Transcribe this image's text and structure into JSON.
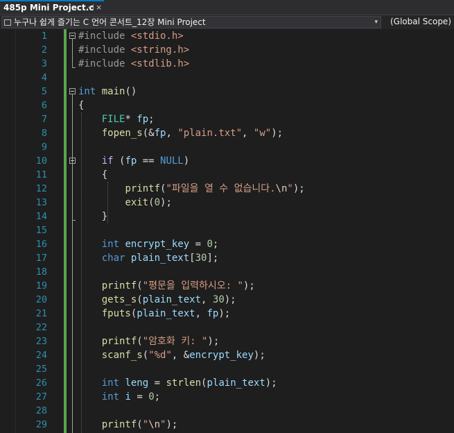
{
  "tab": {
    "title": "485p Mini Project.c",
    "pin": "⊣",
    "close": "×"
  },
  "navbar": {
    "project_scope": "누구나 쉽게 즐기는 C 언어 콘서트_12장 Mini Project",
    "dropdown_glyph": "▾",
    "global_scope": "(Global Scope)"
  },
  "colors": {
    "keyword": "#569cd6",
    "type": "#4ec9b0",
    "function": "#dcdcaa",
    "variable": "#9cdcfe",
    "string": "#d69d85",
    "number": "#b5cea8",
    "line_number": "#2b91af",
    "change_bar": "#57a64a",
    "accent": "#007acc"
  },
  "editor": {
    "lines": [
      {
        "n": "1",
        "tokens": [
          [
            "p",
            "#include "
          ],
          [
            "s",
            "<stdio.h>"
          ]
        ]
      },
      {
        "n": "2",
        "tokens": [
          [
            "p",
            "#include "
          ],
          [
            "s",
            "<string.h>"
          ]
        ]
      },
      {
        "n": "3",
        "tokens": [
          [
            "p",
            "#include "
          ],
          [
            "s",
            "<stdlib.h>"
          ]
        ]
      },
      {
        "n": "4",
        "tokens": []
      },
      {
        "n": "5",
        "tokens": [
          [
            "k",
            "int"
          ],
          [
            "d",
            " "
          ],
          [
            "f",
            "main"
          ],
          [
            "d",
            "()"
          ]
        ]
      },
      {
        "n": "6",
        "tokens": [
          [
            "d",
            "{"
          ]
        ]
      },
      {
        "n": "7",
        "tokens": [
          [
            "d",
            "    "
          ],
          [
            "t",
            "FILE"
          ],
          [
            "d",
            "* "
          ],
          [
            "v",
            "fp"
          ],
          [
            "d",
            ";"
          ]
        ]
      },
      {
        "n": "8",
        "tokens": [
          [
            "d",
            "    "
          ],
          [
            "f",
            "fopen_s"
          ],
          [
            "d",
            "(&"
          ],
          [
            "v",
            "fp"
          ],
          [
            "d",
            ", "
          ],
          [
            "s",
            "\"plain.txt\""
          ],
          [
            "d",
            ", "
          ],
          [
            "s",
            "\"w\""
          ],
          [
            "d",
            ");"
          ]
        ]
      },
      {
        "n": "9",
        "tokens": []
      },
      {
        "n": "10",
        "tokens": [
          [
            "d",
            "    "
          ],
          [
            "m",
            "if"
          ],
          [
            "d",
            " ("
          ],
          [
            "v",
            "fp"
          ],
          [
            "d",
            " == "
          ],
          [
            "k",
            "NULL"
          ],
          [
            "d",
            ")"
          ]
        ]
      },
      {
        "n": "11",
        "tokens": [
          [
            "d",
            "    {"
          ]
        ]
      },
      {
        "n": "12",
        "tokens": [
          [
            "d",
            "        "
          ],
          [
            "f",
            "printf"
          ],
          [
            "d",
            "("
          ],
          [
            "s",
            "\"파일을 열 수 없습니다."
          ],
          [
            "e",
            "\\n"
          ],
          [
            "s",
            "\""
          ],
          [
            "d",
            ");"
          ]
        ]
      },
      {
        "n": "13",
        "tokens": [
          [
            "d",
            "        "
          ],
          [
            "f",
            "exit"
          ],
          [
            "d",
            "("
          ],
          [
            "n",
            "0"
          ],
          [
            "d",
            ");"
          ]
        ]
      },
      {
        "n": "14",
        "tokens": [
          [
            "d",
            "    }"
          ]
        ]
      },
      {
        "n": "15",
        "tokens": []
      },
      {
        "n": "16",
        "tokens": [
          [
            "d",
            "    "
          ],
          [
            "k",
            "int"
          ],
          [
            "d",
            " "
          ],
          [
            "v",
            "encrypt_key"
          ],
          [
            "d",
            " = "
          ],
          [
            "n",
            "0"
          ],
          [
            "d",
            ";"
          ]
        ]
      },
      {
        "n": "17",
        "tokens": [
          [
            "d",
            "    "
          ],
          [
            "k",
            "char"
          ],
          [
            "d",
            " "
          ],
          [
            "v",
            "plain_text"
          ],
          [
            "d",
            "["
          ],
          [
            "n",
            "30"
          ],
          [
            "d",
            "];"
          ]
        ]
      },
      {
        "n": "18",
        "tokens": []
      },
      {
        "n": "19",
        "tokens": [
          [
            "d",
            "    "
          ],
          [
            "f",
            "printf"
          ],
          [
            "d",
            "("
          ],
          [
            "s",
            "\"평문을 입력하시오: \""
          ],
          [
            "d",
            ");"
          ]
        ]
      },
      {
        "n": "20",
        "tokens": [
          [
            "d",
            "    "
          ],
          [
            "f",
            "gets_s"
          ],
          [
            "d",
            "("
          ],
          [
            "v",
            "plain_text"
          ],
          [
            "d",
            ", "
          ],
          [
            "n",
            "30"
          ],
          [
            "d",
            ");"
          ]
        ]
      },
      {
        "n": "21",
        "tokens": [
          [
            "d",
            "    "
          ],
          [
            "f",
            "fputs"
          ],
          [
            "d",
            "("
          ],
          [
            "v",
            "plain_text"
          ],
          [
            "d",
            ", "
          ],
          [
            "v",
            "fp"
          ],
          [
            "d",
            ");"
          ]
        ]
      },
      {
        "n": "22",
        "tokens": []
      },
      {
        "n": "23",
        "tokens": [
          [
            "d",
            "    "
          ],
          [
            "f",
            "printf"
          ],
          [
            "d",
            "("
          ],
          [
            "s",
            "\"암호화 키: \""
          ],
          [
            "d",
            ");"
          ]
        ]
      },
      {
        "n": "24",
        "tokens": [
          [
            "d",
            "    "
          ],
          [
            "f",
            "scanf_s"
          ],
          [
            "d",
            "("
          ],
          [
            "s",
            "\"%d\""
          ],
          [
            "d",
            ", &"
          ],
          [
            "v",
            "encrypt_key"
          ],
          [
            "d",
            ");"
          ]
        ]
      },
      {
        "n": "25",
        "tokens": []
      },
      {
        "n": "26",
        "tokens": [
          [
            "d",
            "    "
          ],
          [
            "k",
            "int"
          ],
          [
            "d",
            " "
          ],
          [
            "v",
            "leng"
          ],
          [
            "d",
            " = "
          ],
          [
            "f",
            "strlen"
          ],
          [
            "d",
            "("
          ],
          [
            "v",
            "plain_text"
          ],
          [
            "d",
            ");"
          ]
        ]
      },
      {
        "n": "27",
        "tokens": [
          [
            "d",
            "    "
          ],
          [
            "k",
            "int"
          ],
          [
            "d",
            " "
          ],
          [
            "v",
            "i"
          ],
          [
            "d",
            " = "
          ],
          [
            "n",
            "0"
          ],
          [
            "d",
            ";"
          ]
        ]
      },
      {
        "n": "28",
        "tokens": []
      },
      {
        "n": "29",
        "tokens": [
          [
            "d",
            "    "
          ],
          [
            "f",
            "printf"
          ],
          [
            "d",
            "("
          ],
          [
            "s",
            "\""
          ],
          [
            "e",
            "\\n"
          ],
          [
            "s",
            "\""
          ],
          [
            "d",
            ");"
          ]
        ]
      }
    ]
  }
}
